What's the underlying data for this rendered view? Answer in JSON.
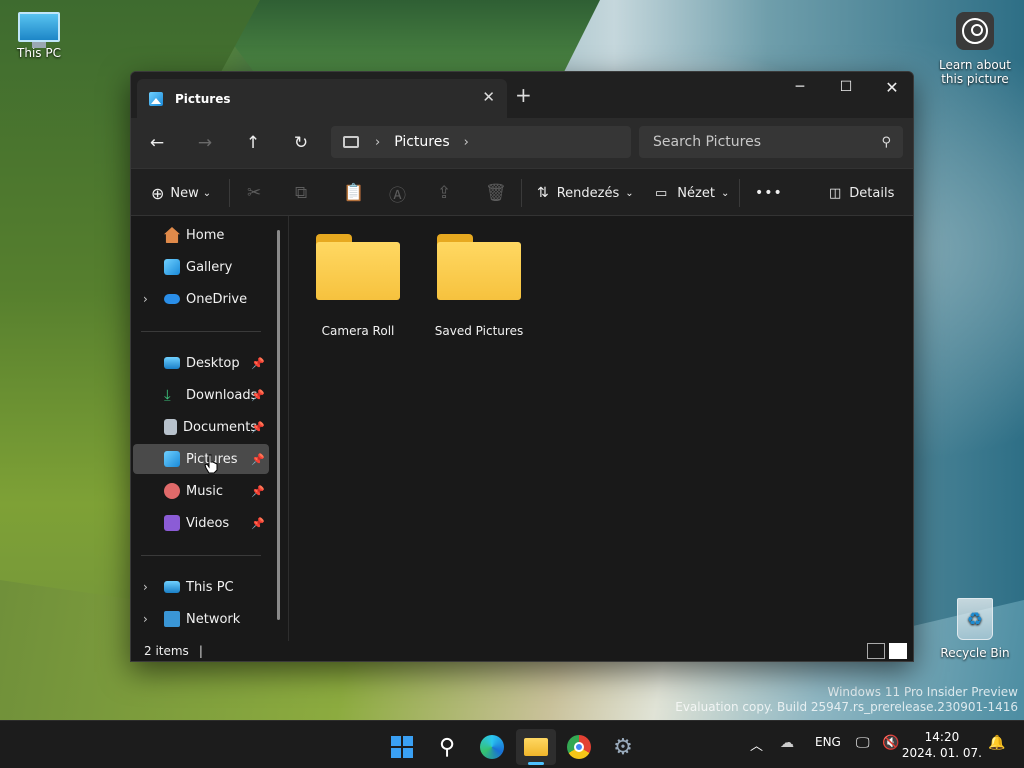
{
  "desktop": {
    "icons": [
      {
        "label": "This PC"
      },
      {
        "label": "Learn about this picture"
      },
      {
        "label": "Recycle Bin"
      }
    ],
    "watermark_line1": "Windows 11 Pro Insider Preview",
    "watermark_line2": "Evaluation copy. Build 25947.rs_prerelease.230901-1416"
  },
  "window": {
    "tab_title": "Pictures",
    "address": {
      "location": "Pictures"
    },
    "search": {
      "placeholder": "Search Pictures"
    },
    "toolbar": {
      "new_label": "New",
      "sort_label": "Rendezés",
      "view_label": "Nézet",
      "more_label": "•••",
      "details_label": "Details"
    },
    "nav": {
      "items": [
        {
          "label": "Home"
        },
        {
          "label": "Gallery"
        },
        {
          "label": "OneDrive"
        },
        {
          "label": "Desktop"
        },
        {
          "label": "Downloads"
        },
        {
          "label": "Documents"
        },
        {
          "label": "Pictures"
        },
        {
          "label": "Music"
        },
        {
          "label": "Videos"
        },
        {
          "label": "This PC"
        },
        {
          "label": "Network"
        }
      ],
      "selected": "Pictures"
    },
    "folders": [
      {
        "name": "Camera Roll"
      },
      {
        "name": "Saved Pictures"
      }
    ],
    "status": {
      "item_count": "2 items"
    }
  },
  "taskbar": {
    "apps": [
      "start-icon",
      "search-icon",
      "edge-pre-icon",
      "file-explorer-icon",
      "chrome-icon",
      "settings-icon"
    ],
    "active_app": "file-explorer-icon",
    "language": "ENG",
    "time": "14:20",
    "date": "2024. 01. 07."
  },
  "colors": {
    "accent": "#4cc2ff",
    "folder": "#f6c23e",
    "window_bg": "#191919"
  }
}
